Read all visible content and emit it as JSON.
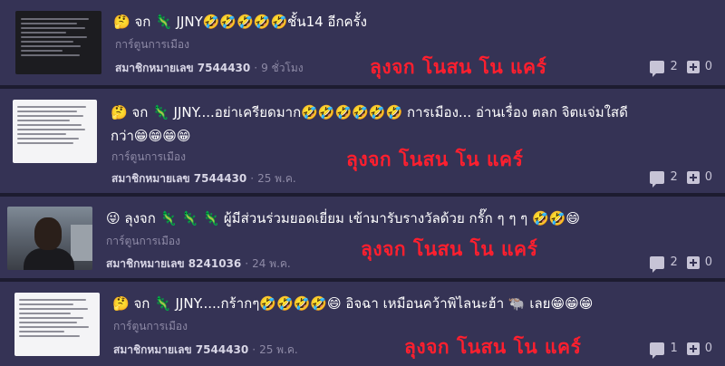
{
  "posts": [
    {
      "title": "🤔 จก 🦎 JJNY🤣🤣🤣🤣🤣ชั้น14 อีกครั้ง",
      "tag": "การ์ตูนการเมือง",
      "member": "สมาชิกหมายเลข 7544430",
      "time": "9 ชั่วโมง",
      "banner": "ลุงจก  โนสน โน แคร์",
      "comments": "2",
      "votes": "0"
    },
    {
      "title_line1": "🤔 จก 🦎 JJNY....อย่าเครียดมาก🤣🤣🤣🤣🤣🤣 การเมือง... อ่านเรื่อง ตลก จิตแจ่มใสดี",
      "title_line2": "กว่า😁😁😁😁",
      "tag": "การ์ตูนการเมือง",
      "member": "สมาชิกหมายเลข 7544430",
      "time": "25 พ.ค.",
      "banner": "ลุงจก  โนสน โน แคร์",
      "comments": "2",
      "votes": "0"
    },
    {
      "title": "😜 ลุงจก 🦎 🦎 🦎 ผู้มีส่วนร่วมยอดเยี่ยม เข้ามารับรางวัลด้วย กรั๊ก ๆ ๆ ๆ 🤣🤣😄",
      "tag": "การ์ตูนการเมือง",
      "member": "สมาชิกหมายเลข 8241036",
      "time": "24 พ.ค.",
      "banner": "ลุงจก  โนสน โน แคร์",
      "comments": "2",
      "votes": "0"
    },
    {
      "title": "🤔 จก 🦎 JJNY.....กร้ากๆ🤣🤣🤣🤣😄 อิจฉา เหมือนคว้าพิไลนะฮ้า 🐃 เลย😁😁😁",
      "tag": "การ์ตูนการเมือง",
      "member": "สมาชิกหมายเลข 7544430",
      "time": "25 พ.ค.",
      "banner": "ลุงจก  โนสน โน แคร์",
      "comments": "1",
      "votes": "0"
    }
  ]
}
